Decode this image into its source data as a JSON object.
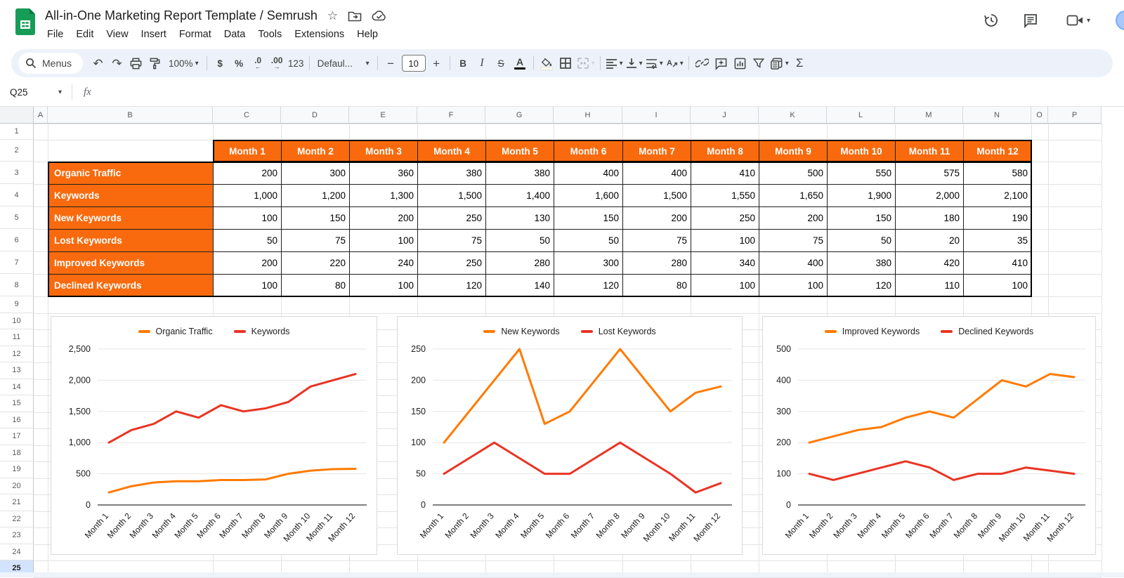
{
  "header": {
    "title": "All-in-One Marketing Report Template / Semrush",
    "menu_items": [
      "File",
      "Edit",
      "View",
      "Insert",
      "Format",
      "Data",
      "Tools",
      "Extensions",
      "Help"
    ]
  },
  "toolbar": {
    "menus_label": "Menus",
    "zoom_value": "100%",
    "currency": "$",
    "percent": "%",
    "decimal_decrease": ".0",
    "decimal_increase": ".00",
    "more_formats": "123",
    "font_name": "Defaul...",
    "minus": "−",
    "font_size": "10",
    "plus": "+",
    "bold": "B",
    "italic": "I",
    "strikethrough": "S",
    "text_color": "A",
    "sum": "Σ"
  },
  "formula_bar": {
    "name_box": "Q25",
    "fx_label": "fx"
  },
  "grid": {
    "column_headers": [
      "A",
      "B",
      "C",
      "D",
      "E",
      "F",
      "G",
      "H",
      "I",
      "J",
      "K",
      "L",
      "M",
      "N",
      "O",
      "P"
    ],
    "row_headers": [
      "1",
      "2",
      "3",
      "4",
      "5",
      "6",
      "7",
      "8",
      "9",
      "10",
      "11",
      "12",
      "13",
      "14",
      "15",
      "16",
      "17",
      "18",
      "19",
      "20",
      "21",
      "22",
      "23",
      "24",
      "25"
    ],
    "selected_row": "25"
  },
  "table": {
    "month_headers": [
      "Month 1",
      "Month 2",
      "Month 3",
      "Month 4",
      "Month 5",
      "Month 6",
      "Month 7",
      "Month 8",
      "Month 9",
      "Month 10",
      "Month 11",
      "Month 12"
    ],
    "rows": [
      {
        "label": "Organic Traffic",
        "values": [
          "200",
          "300",
          "360",
          "380",
          "380",
          "400",
          "400",
          "410",
          "500",
          "550",
          "575",
          "580"
        ]
      },
      {
        "label": "Keywords",
        "values": [
          "1,000",
          "1,200",
          "1,300",
          "1,500",
          "1,400",
          "1,600",
          "1,500",
          "1,550",
          "1,650",
          "1,900",
          "2,000",
          "2,100"
        ]
      },
      {
        "label": "New Keywords",
        "values": [
          "100",
          "150",
          "200",
          "250",
          "130",
          "150",
          "200",
          "250",
          "200",
          "150",
          "180",
          "190"
        ]
      },
      {
        "label": "Lost Keywords",
        "values": [
          "50",
          "75",
          "100",
          "75",
          "50",
          "50",
          "75",
          "100",
          "75",
          "50",
          "20",
          "35"
        ]
      },
      {
        "label": "Improved Keywords",
        "values": [
          "200",
          "220",
          "240",
          "250",
          "280",
          "300",
          "280",
          "340",
          "400",
          "380",
          "420",
          "410"
        ]
      },
      {
        "label": "Declined Keywords",
        "values": [
          "100",
          "80",
          "100",
          "120",
          "140",
          "120",
          "80",
          "100",
          "100",
          "120",
          "110",
          "100"
        ]
      }
    ],
    "accent_color": "#f86a0d"
  },
  "chart_data": [
    {
      "type": "line",
      "categories": [
        "Month 1",
        "Month 2",
        "Month 3",
        "Month 4",
        "Month 5",
        "Month 6",
        "Month 7",
        "Month 8",
        "Month 9",
        "Month 10",
        "Month 11",
        "Month 12"
      ],
      "series": [
        {
          "name": "Organic Traffic",
          "color": "#ff7a00",
          "values": [
            200,
            300,
            360,
            380,
            380,
            400,
            400,
            410,
            500,
            550,
            575,
            580
          ]
        },
        {
          "name": "Keywords",
          "color": "#ea3323",
          "values": [
            1000,
            1200,
            1300,
            1500,
            1400,
            1600,
            1500,
            1550,
            1650,
            1900,
            2000,
            2100
          ]
        }
      ],
      "ylim": [
        0,
        2500
      ],
      "yticks": [
        0,
        500,
        1000,
        1500,
        2000,
        2500
      ],
      "grid": true,
      "legend_position": "top"
    },
    {
      "type": "line",
      "categories": [
        "Month 1",
        "Month 2",
        "Month 3",
        "Month 4",
        "Month 5",
        "Month 6",
        "Month 7",
        "Month 8",
        "Month 9",
        "Month 10",
        "Month 11",
        "Month 12"
      ],
      "series": [
        {
          "name": "New Keywords",
          "color": "#ff7a00",
          "values": [
            100,
            150,
            200,
            250,
            130,
            150,
            200,
            250,
            200,
            150,
            180,
            190
          ]
        },
        {
          "name": "Lost Keywords",
          "color": "#ea3323",
          "values": [
            50,
            75,
            100,
            75,
            50,
            50,
            75,
            100,
            75,
            50,
            20,
            35
          ]
        }
      ],
      "ylim": [
        0,
        250
      ],
      "yticks": [
        0,
        50,
        100,
        150,
        200,
        250
      ],
      "grid": true,
      "legend_position": "top"
    },
    {
      "type": "line",
      "categories": [
        "Month 1",
        "Month 2",
        "Month 3",
        "Month 4",
        "Month 5",
        "Month 6",
        "Month 7",
        "Month 8",
        "Month 9",
        "Month 10",
        "Month 11",
        "Month 12"
      ],
      "series": [
        {
          "name": "Improved Keywords",
          "color": "#ff7a00",
          "values": [
            200,
            220,
            240,
            250,
            280,
            300,
            280,
            340,
            400,
            380,
            420,
            410
          ]
        },
        {
          "name": "Declined Keywords",
          "color": "#ea3323",
          "values": [
            100,
            80,
            100,
            120,
            140,
            120,
            80,
            100,
            100,
            120,
            110,
            100
          ]
        }
      ],
      "ylim": [
        0,
        500
      ],
      "yticks": [
        0,
        100,
        200,
        300,
        400,
        500
      ],
      "grid": true,
      "legend_position": "top"
    }
  ]
}
